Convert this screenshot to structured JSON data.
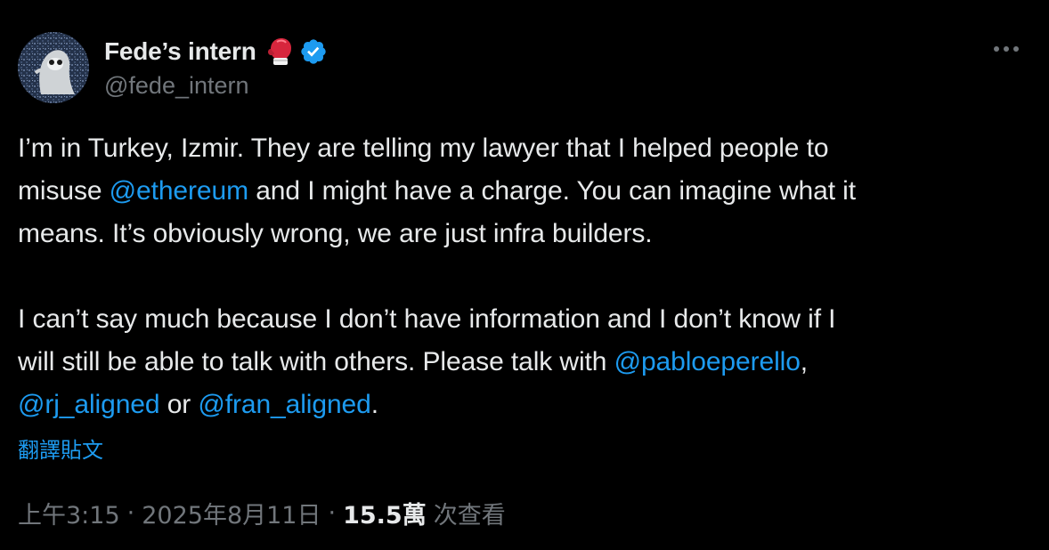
{
  "author": {
    "display_name": "Fede’s intern",
    "handle": "@fede_intern",
    "badge_emoji": "boxing-glove-icon",
    "verified": true,
    "verified_color": "#1d9bf0"
  },
  "tweet": {
    "lines": [
      [
        {
          "t": "I’m in Turkey, Izmir.  They are telling my lawyer that I helped people to"
        }
      ],
      [
        {
          "t": "misuse "
        },
        {
          "t": "@ethereum",
          "m": true
        },
        {
          "t": " and I might have a charge. You can imagine what it"
        }
      ],
      [
        {
          "t": "means. It’s obviously wrong, we are just infra builders."
        }
      ],
      [
        {
          "t": ""
        }
      ],
      [
        {
          "t": "I can’t say much because I don’t have information and I don’t know if I"
        }
      ],
      [
        {
          "t": "will still be able to talk with others. Please talk with "
        },
        {
          "t": "@pabloeperello",
          "m": true
        },
        {
          "t": ","
        }
      ],
      [
        {
          "t": "@rj_aligned",
          "m": true
        },
        {
          "t": " or "
        },
        {
          "t": "@fran_aligned",
          "m": true
        },
        {
          "t": "."
        }
      ]
    ]
  },
  "translate_label": "翻譯貼文",
  "meta": {
    "time": "上午3:15",
    "separator": "·",
    "date": "2025年8月11日",
    "views_count": "15.5萬",
    "views_label": "次查看"
  },
  "colors": {
    "background": "#000000",
    "text": "#e7e9ea",
    "muted": "#71767b",
    "link": "#1d9bf0"
  }
}
